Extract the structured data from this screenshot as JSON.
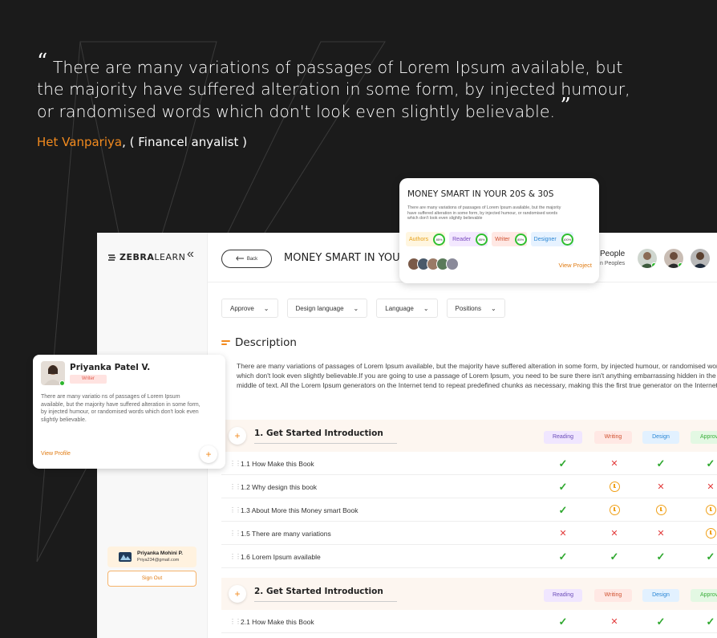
{
  "quote": {
    "open_mark": "“",
    "text": "There are many variations of passages of Lorem Ipsum available, but the majority have suffered alteration in some form, by injected humour, or randomised words which don't look even slightly believable.",
    "close_mark": "”",
    "author_name": "Het Vanpariya",
    "author_role": ", ( Financel anyalist )"
  },
  "sidebar": {
    "logo_bold": "ZEBRA",
    "logo_light": "LEARN",
    "collapse_icon": "double-chevron-left-icon",
    "user": {
      "name": "Priyanka Mohini P.",
      "email": "Priya234@gmail.com"
    },
    "signout_label": "Sign Out"
  },
  "topbar": {
    "back_label": "Back",
    "title": "MONEY SMART IN YOUR",
    "people_label": "People",
    "people_sub": "n Peoples"
  },
  "filters": [
    {
      "label": "Approve"
    },
    {
      "label": "Design language"
    },
    {
      "label": "Language"
    },
    {
      "label": "Positions"
    }
  ],
  "description": {
    "heading": "Description",
    "text": "There are many variations of passages of Lorem Ipsum available, but the majority have suffered alteration in some form, by injected humour, or randomised words which don't look even slightly believable.If you are going to use a passage of Lorem Ipsum, you need to be sure there isn't anything embarrassing hidden in the middle of text. All the Lorem Ipsum generators on the Internet tend to repeat predefined chunks as necessary, making this the first true generator on the Internet."
  },
  "status_tags": {
    "reading": "Reading",
    "writing": "Writing",
    "design": "Design",
    "approve": "Approve"
  },
  "sections": [
    {
      "title": "1. Get Started Introduction",
      "rows": [
        {
          "label": "1.1 How Make this Book",
          "status": [
            "done",
            "rejected",
            "done",
            "done"
          ]
        },
        {
          "label": "1.2 Why design this book",
          "status": [
            "done",
            "pending",
            "rejected",
            "rejected"
          ]
        },
        {
          "label": "1.3 About More this Money smart Book",
          "status": [
            "done",
            "pending",
            "pending",
            "pending"
          ]
        },
        {
          "label": "1.5 There are many variations",
          "status": [
            "rejected",
            "rejected",
            "rejected",
            "pending"
          ]
        },
        {
          "label": "1.6 Lorem Ipsum available",
          "status": [
            "done",
            "done",
            "done",
            "done"
          ]
        }
      ]
    },
    {
      "title": "2. Get Started Introduction",
      "rows": [
        {
          "label": "2.1 How Make this Book",
          "status": [
            "done",
            "rejected",
            "done",
            "done"
          ]
        }
      ]
    }
  ],
  "project_card": {
    "title": "MONEY SMART IN YOUR 20S & 30S",
    "text": "There are many variations of passages of Lorem Ipsum available, but the majority have suffered alteration in some form, by injected humour, or randomised words which don't look even slightly believable",
    "pills": [
      {
        "label": "Authors",
        "percent": "85%",
        "bg": "#fff6e0",
        "color": "#e6a11a"
      },
      {
        "label": "Reader",
        "percent": "85%",
        "bg": "#f3e8ff",
        "color": "#7a4bc0"
      },
      {
        "label": "Writer",
        "percent": "85%",
        "bg": "#ffe8e4",
        "color": "#d0502f"
      },
      {
        "label": "Designer",
        "percent": "100%",
        "bg": "#e6f2ff",
        "color": "#2a86d4"
      }
    ],
    "link": "View Project"
  },
  "profile_card": {
    "name": "Priyanka Patel V.",
    "role": "Writer",
    "text": "There are many variatio ns of passages of Lorem Ipsum available, but the majority have suffered alteration in some form, by injected humour, or randomised words which don't look even slightly believable.",
    "link": "View Profile"
  },
  "colors": {
    "accent": "#f28a1e",
    "background": "#1b1b1b",
    "done": "#2fa82f",
    "rejected": "#e23b3b",
    "pending": "#f0a11a"
  }
}
